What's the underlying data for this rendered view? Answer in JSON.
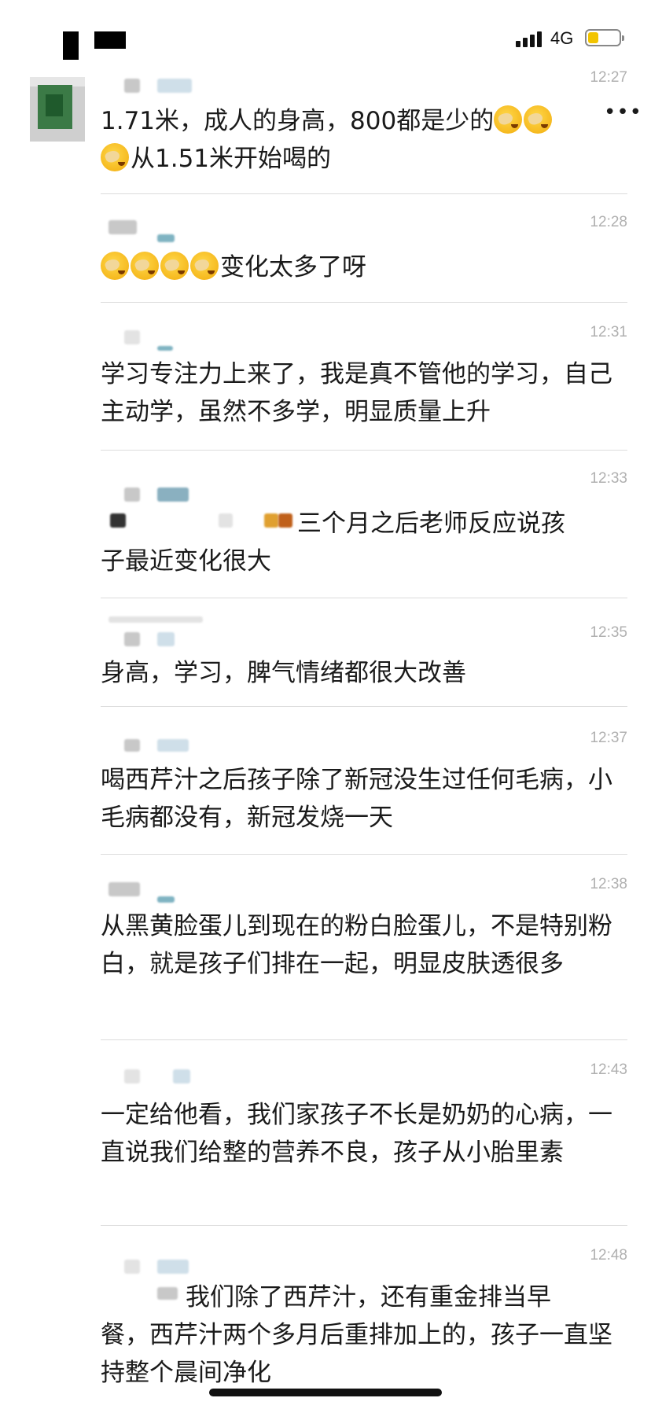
{
  "status_bar": {
    "network": "4G",
    "battery_level": 0.35
  },
  "messages": [
    {
      "time": "12:27",
      "text_a": "1.71米，成人的身高，800都是少的",
      "text_b": "从1.51米开始喝的",
      "overflow": "•••"
    },
    {
      "time": "12:28",
      "text": "变化太多了呀"
    },
    {
      "time": "12:31",
      "text": "学习专注力上来了，我是真不管他的学习，自己主动学，虽然不多学，明显质量上升"
    },
    {
      "time": "12:33",
      "text_a": "三个月之后老师反应说孩",
      "text_b": "子最近变化很大"
    },
    {
      "time": "12:35",
      "text": "身高，学习，脾气情绪都很大改善"
    },
    {
      "time": "12:37",
      "text": "喝西芹汁之后孩子除了新冠没生过任何毛病，小毛病都没有，新冠发烧一天"
    },
    {
      "time": "12:38",
      "text": "从黑黄脸蛋儿到现在的粉白脸蛋儿，不是特别粉白，就是孩子们排在一起，明显皮肤透很多"
    },
    {
      "time": "12:43",
      "text": "一定给他看，我们家孩子不长是奶奶的心病，一直说我们给整的营养不良，孩子从小胎里素"
    },
    {
      "time": "12:48",
      "text_a": "我们除了西芹汁，还有重金排当早",
      "text_b": "餐，西芹汁两个多月后重排加上的，孩子一直坚持整个晨间净化"
    }
  ]
}
